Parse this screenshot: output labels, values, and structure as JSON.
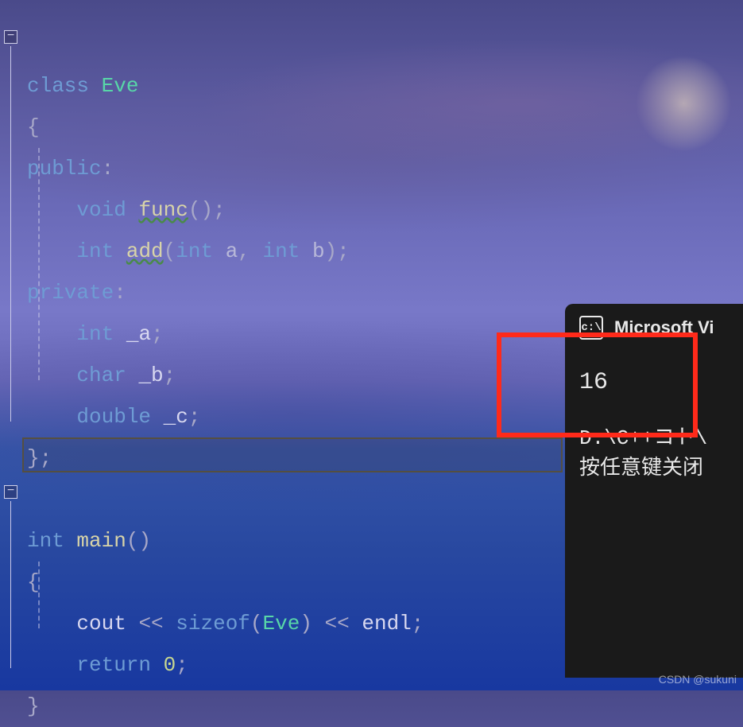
{
  "code": {
    "l1_class": "class",
    "l1_name": "Eve",
    "l2_brace": "{",
    "l3_public": "public",
    "l3_colon": ":",
    "l4_void": "void",
    "l4_func": "func",
    "l4_parens": "()",
    "l4_semi": ";",
    "l5_int": "int",
    "l5_add": "add",
    "l5_open": "(",
    "l5_int_a": "int",
    "l5_a": "a",
    "l5_comma": ",",
    "l5_int_b": "int",
    "l5_b": "b",
    "l5_close": ")",
    "l5_semi": ";",
    "l6_private": "private",
    "l6_colon": ":",
    "l7_int": "int",
    "l7_a": "_a",
    "l7_semi": ";",
    "l8_char": "char",
    "l8_b": "_b",
    "l8_semi": ";",
    "l9_double": "double",
    "l9_c": "_c",
    "l9_semi": ";",
    "l10_brace": "}",
    "l10_semi": ";",
    "l12_int": "int",
    "l12_main": "main",
    "l12_parens": "()",
    "l13_brace": "{",
    "l14_cout": "cout",
    "l14_op1": "<<",
    "l14_sizeof": "sizeof",
    "l14_open": "(",
    "l14_eve": "Eve",
    "l14_close": ")",
    "l14_op2": "<<",
    "l14_endl": "endl",
    "l14_semi": ";",
    "l15_return": "return",
    "l15_zero": "0",
    "l15_semi": ";",
    "l16_brace": "}"
  },
  "console": {
    "icon_text": "c:\\",
    "title": "Microsoft Vi",
    "output": "16",
    "path": "D:\\C++コト\\",
    "prompt": "按任意键关闭"
  },
  "watermark": "CSDN @sukuni",
  "fold": {
    "minus": "−"
  }
}
